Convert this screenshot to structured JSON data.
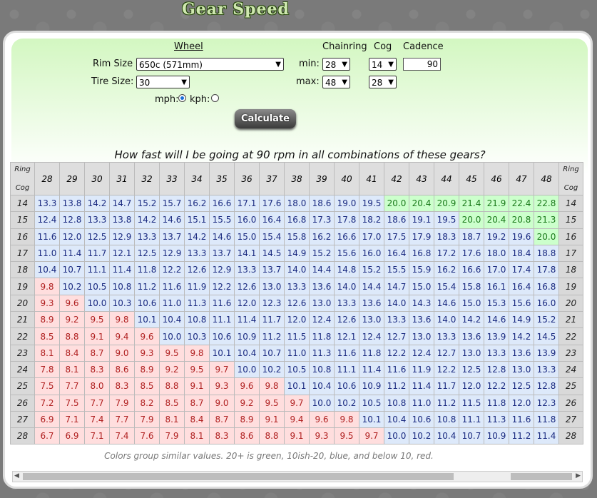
{
  "app": {
    "title": "Gear Speed"
  },
  "form": {
    "wheel_header": "Wheel",
    "chainring_header": "Chainring",
    "cog_header": "Cog",
    "cadence_header": "Cadence",
    "rim_label": "Rim Size",
    "rim_value": "650c (571mm)",
    "tire_label": "Tire Size:",
    "tire_value": "30",
    "min_label": "min:",
    "max_label": "max:",
    "chainring_min": "28",
    "chainring_max": "48",
    "cog_min": "14",
    "cog_max": "28",
    "cadence_value": "90",
    "mph_label": "mph:",
    "kph_label": "kph:",
    "units_selected": "mph",
    "calculate_label": "Calculate"
  },
  "question": "How fast will I be going at 90 rpm in all combinations of these gears?",
  "table": {
    "corner_top": "Ring",
    "corner_bottom": "Cog",
    "rings": [
      "28",
      "29",
      "30",
      "31",
      "32",
      "33",
      "34",
      "35",
      "36",
      "37",
      "38",
      "39",
      "40",
      "41",
      "42",
      "43",
      "44",
      "45",
      "46",
      "47",
      "48"
    ],
    "rows": [
      {
        "cog": "14",
        "values": [
          "13.3",
          "13.8",
          "14.2",
          "14.7",
          "15.2",
          "15.7",
          "16.2",
          "16.6",
          "17.1",
          "17.6",
          "18.0",
          "18.6",
          "19.0",
          "19.5",
          "20.0",
          "20.4",
          "20.9",
          "21.4",
          "21.9",
          "22.4",
          "22.8"
        ]
      },
      {
        "cog": "15",
        "values": [
          "12.4",
          "12.8",
          "13.3",
          "13.8",
          "14.2",
          "14.6",
          "15.1",
          "15.5",
          "16.0",
          "16.4",
          "16.8",
          "17.3",
          "17.8",
          "18.2",
          "18.6",
          "19.1",
          "19.5",
          "20.0",
          "20.4",
          "20.8",
          "21.3"
        ]
      },
      {
        "cog": "16",
        "values": [
          "11.6",
          "12.0",
          "12.5",
          "12.9",
          "13.3",
          "13.7",
          "14.2",
          "14.6",
          "15.0",
          "15.4",
          "15.8",
          "16.2",
          "16.6",
          "17.0",
          "17.5",
          "17.9",
          "18.3",
          "18.7",
          "19.2",
          "19.6",
          "20.0"
        ]
      },
      {
        "cog": "17",
        "values": [
          "11.0",
          "11.4",
          "11.7",
          "12.1",
          "12.5",
          "12.9",
          "13.3",
          "13.7",
          "14.1",
          "14.5",
          "14.9",
          "15.2",
          "15.6",
          "16.0",
          "16.4",
          "16.8",
          "17.2",
          "17.6",
          "18.0",
          "18.4",
          "18.8"
        ]
      },
      {
        "cog": "18",
        "values": [
          "10.4",
          "10.7",
          "11.1",
          "11.4",
          "11.8",
          "12.2",
          "12.6",
          "12.9",
          "13.3",
          "13.7",
          "14.0",
          "14.4",
          "14.8",
          "15.2",
          "15.5",
          "15.9",
          "16.2",
          "16.6",
          "17.0",
          "17.4",
          "17.8"
        ]
      },
      {
        "cog": "19",
        "values": [
          "9.8",
          "10.2",
          "10.5",
          "10.8",
          "11.2",
          "11.6",
          "11.9",
          "12.2",
          "12.6",
          "13.0",
          "13.3",
          "13.6",
          "14.0",
          "14.4",
          "14.7",
          "15.0",
          "15.4",
          "15.8",
          "16.1",
          "16.4",
          "16.8"
        ]
      },
      {
        "cog": "20",
        "values": [
          "9.3",
          "9.6",
          "10.0",
          "10.3",
          "10.6",
          "11.0",
          "11.3",
          "11.6",
          "12.0",
          "12.3",
          "12.6",
          "13.0",
          "13.3",
          "13.6",
          "14.0",
          "14.3",
          "14.6",
          "15.0",
          "15.3",
          "15.6",
          "16.0"
        ]
      },
      {
        "cog": "21",
        "values": [
          "8.9",
          "9.2",
          "9.5",
          "9.8",
          "10.1",
          "10.4",
          "10.8",
          "11.1",
          "11.4",
          "11.7",
          "12.0",
          "12.4",
          "12.6",
          "13.0",
          "13.3",
          "13.6",
          "14.0",
          "14.2",
          "14.6",
          "14.9",
          "15.2"
        ]
      },
      {
        "cog": "22",
        "values": [
          "8.5",
          "8.8",
          "9.1",
          "9.4",
          "9.6",
          "10.0",
          "10.3",
          "10.6",
          "10.9",
          "11.2",
          "11.5",
          "11.8",
          "12.1",
          "12.4",
          "12.7",
          "13.0",
          "13.3",
          "13.6",
          "13.9",
          "14.2",
          "14.5"
        ]
      },
      {
        "cog": "23",
        "values": [
          "8.1",
          "8.4",
          "8.7",
          "9.0",
          "9.3",
          "9.5",
          "9.8",
          "10.1",
          "10.4",
          "10.7",
          "11.0",
          "11.3",
          "11.6",
          "11.8",
          "12.2",
          "12.4",
          "12.7",
          "13.0",
          "13.3",
          "13.6",
          "13.9"
        ]
      },
      {
        "cog": "24",
        "values": [
          "7.8",
          "8.1",
          "8.3",
          "8.6",
          "8.9",
          "9.2",
          "9.5",
          "9.7",
          "10.0",
          "10.2",
          "10.5",
          "10.8",
          "11.1",
          "11.4",
          "11.6",
          "11.9",
          "12.2",
          "12.5",
          "12.8",
          "13.0",
          "13.3"
        ]
      },
      {
        "cog": "25",
        "values": [
          "7.5",
          "7.7",
          "8.0",
          "8.3",
          "8.5",
          "8.8",
          "9.1",
          "9.3",
          "9.6",
          "9.8",
          "10.1",
          "10.4",
          "10.6",
          "10.9",
          "11.2",
          "11.4",
          "11.7",
          "12.0",
          "12.2",
          "12.5",
          "12.8"
        ]
      },
      {
        "cog": "26",
        "values": [
          "7.2",
          "7.5",
          "7.7",
          "7.9",
          "8.2",
          "8.5",
          "8.7",
          "9.0",
          "9.2",
          "9.5",
          "9.7",
          "10.0",
          "10.2",
          "10.5",
          "10.8",
          "11.0",
          "11.2",
          "11.5",
          "11.8",
          "12.0",
          "12.3"
        ]
      },
      {
        "cog": "27",
        "values": [
          "6.9",
          "7.1",
          "7.4",
          "7.7",
          "7.9",
          "8.1",
          "8.4",
          "8.7",
          "8.9",
          "9.1",
          "9.4",
          "9.6",
          "9.8",
          "10.1",
          "10.4",
          "10.6",
          "10.8",
          "11.1",
          "11.3",
          "11.6",
          "11.8"
        ]
      },
      {
        "cog": "28",
        "values": [
          "6.7",
          "6.9",
          "7.1",
          "7.4",
          "7.6",
          "7.9",
          "8.1",
          "8.3",
          "8.6",
          "8.8",
          "9.1",
          "9.3",
          "9.5",
          "9.7",
          "10.0",
          "10.2",
          "10.4",
          "10.7",
          "10.9",
          "11.2",
          "11.4"
        ]
      }
    ]
  },
  "note": "Colors group similar values. 20+ is green, 10ish-20, blue, and below 10, red.",
  "colors": {
    "green_bg": "#ccffcc",
    "blue_bg": "#dde9fa",
    "red_bg": "#ffdede"
  }
}
